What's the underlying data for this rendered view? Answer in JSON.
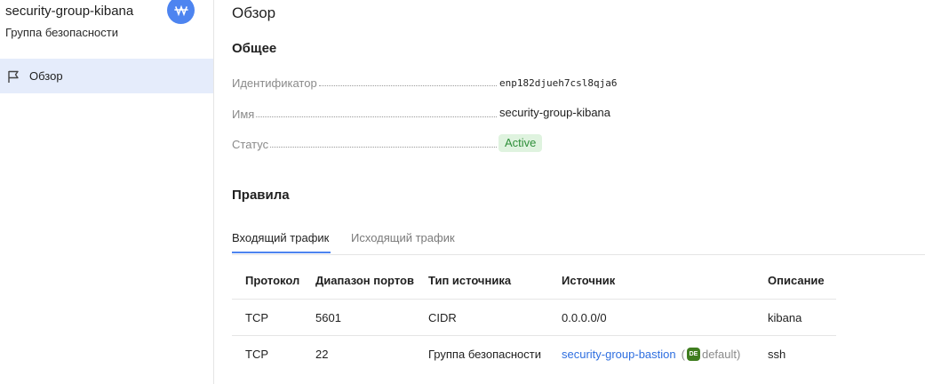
{
  "sidebar": {
    "resource_title": "security-group-kibana",
    "resource_subtitle": "Группа безопасности",
    "items": [
      {
        "label": "Обзор",
        "icon": "flag-icon"
      }
    ],
    "accent": "#4d84f0"
  },
  "page": {
    "title": "Обзор"
  },
  "general": {
    "heading": "Общее",
    "fields": [
      {
        "key": "Идентификатор",
        "value": "enp182djueh7csl8qja6"
      },
      {
        "key": "Имя",
        "value": "security-group-kibana"
      },
      {
        "key": "Статус",
        "value": "Active"
      }
    ],
    "status_color": "#2f8f3a"
  },
  "rules": {
    "heading": "Правила",
    "tabs": [
      {
        "label": "Входящий трафик",
        "active": true
      },
      {
        "label": "Исходящий трафик",
        "active": false
      }
    ],
    "columns": [
      "Протокол",
      "Диапазон портов",
      "Тип источника",
      "Источник",
      "Описание"
    ],
    "rows": [
      {
        "protocol": "TCP",
        "ports": "5601",
        "source_type": "CIDR",
        "source": "0.0.0.0/0",
        "description": "kibana"
      },
      {
        "protocol": "TCP",
        "ports": "22",
        "source_type": "Группа безопасности",
        "source_link": "security-group-bastion",
        "source_tag": "DE",
        "source_note": "default",
        "paren_open": "(",
        "paren_close": ")",
        "description": "ssh"
      }
    ]
  }
}
